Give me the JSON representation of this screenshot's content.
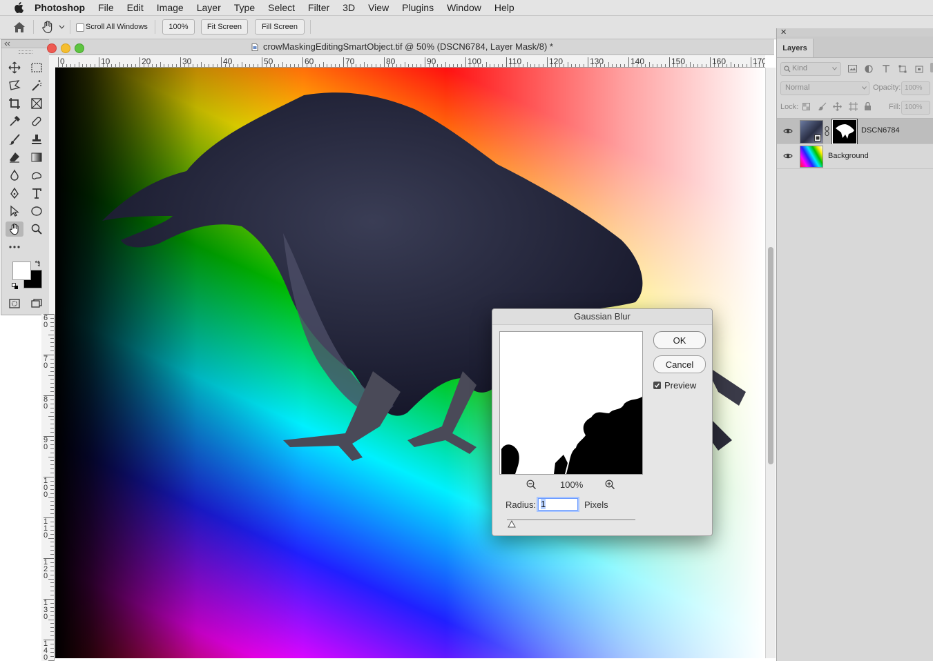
{
  "menubar": {
    "app": "Photoshop",
    "items": [
      "File",
      "Edit",
      "Image",
      "Layer",
      "Type",
      "Select",
      "Filter",
      "3D",
      "View",
      "Plugins",
      "Window",
      "Help"
    ]
  },
  "options": {
    "scroll_all_label": "Scroll All Windows",
    "zoom_100": "100%",
    "fit_screen": "Fit Screen",
    "fill_screen": "Fill Screen"
  },
  "document": {
    "title": "crowMaskingEditingSmartObject.tif @ 50% (DSCN6784, Layer Mask/8) *",
    "ruler_h": [
      "0",
      "10",
      "20",
      "30",
      "40",
      "50",
      "60",
      "70",
      "80",
      "90",
      "100",
      "110",
      "120",
      "130",
      "140",
      "150",
      "160",
      "170"
    ],
    "ruler_v": [
      "6\n0",
      "7\n0",
      "8\n0",
      "9\n0",
      "1\n0\n0",
      "1\n1\n0",
      "1\n2\n0",
      "1\n3\n0",
      "1\n4\n0"
    ]
  },
  "layers_panel": {
    "tab": "Layers",
    "kind": "Kind",
    "blend_mode": "Normal",
    "opacity_label": "Opacity:",
    "opacity_value": "100%",
    "lock_label": "Lock:",
    "fill_label": "Fill:",
    "fill_value": "100%",
    "layers": [
      {
        "name": "DSCN6784",
        "selected": true
      },
      {
        "name": "Background",
        "selected": false
      }
    ]
  },
  "dialog": {
    "title": "Gaussian Blur",
    "ok": "OK",
    "cancel": "Cancel",
    "preview_label": "Preview",
    "preview_checked": true,
    "zoom_value": "100%",
    "radius_label": "Radius:",
    "radius_value": "1",
    "unit": "Pixels"
  },
  "colors": {
    "accent": "#3b82f6",
    "menubar_bg": "#e4e4e4",
    "panel_bg": "#d8d8d8"
  }
}
